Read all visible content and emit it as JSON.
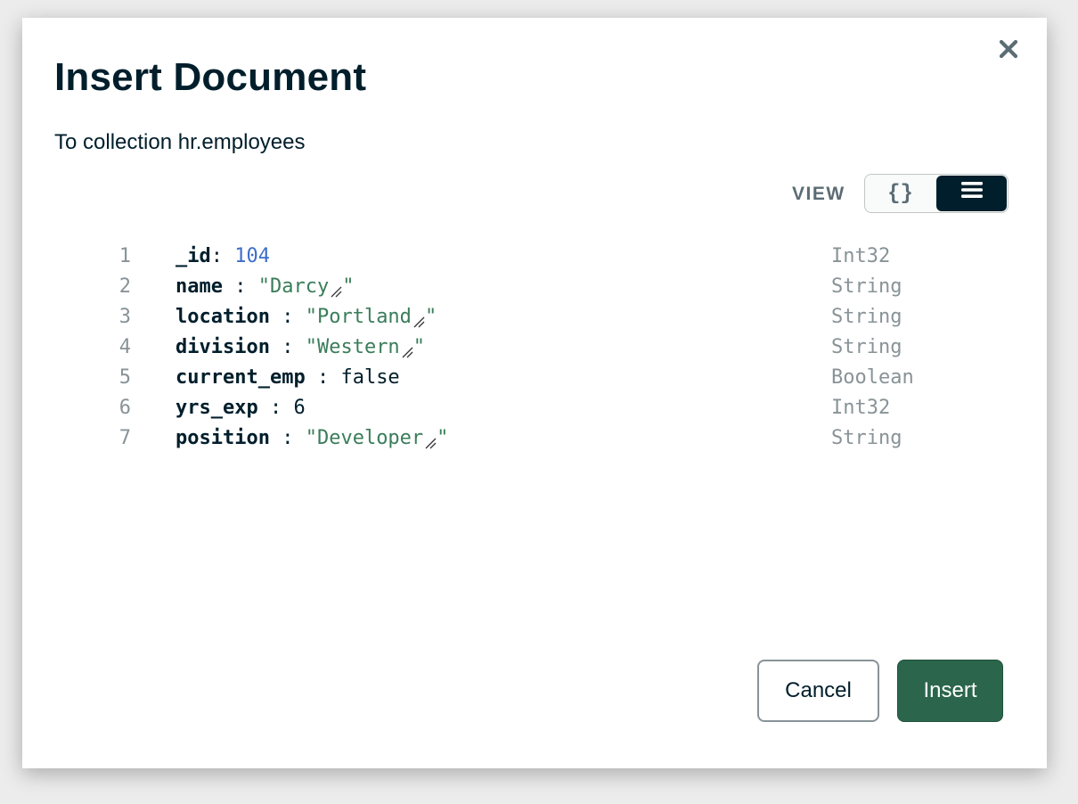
{
  "modal": {
    "title": "Insert Document",
    "subtitle": "To collection hr.employees",
    "close_icon": "close-icon"
  },
  "view_toggle": {
    "label": "VIEW",
    "options": [
      {
        "name": "json-view",
        "icon": "curly-braces-icon",
        "glyph": "{}",
        "active": false
      },
      {
        "name": "list-view",
        "icon": "list-icon",
        "active": true
      }
    ]
  },
  "document": {
    "fields": [
      {
        "line": "1",
        "key": "_id",
        "sep": ": ",
        "value": "104",
        "kind": "number",
        "type": "Int32"
      },
      {
        "line": "2",
        "key": "name",
        "sep": " : ",
        "value": "\"Darcy",
        "end": "\"",
        "kind": "string",
        "type": "String"
      },
      {
        "line": "3",
        "key": "location",
        "sep": " : ",
        "value": "\"Portland",
        "end": "\"",
        "kind": "string",
        "type": "String"
      },
      {
        "line": "4",
        "key": "division",
        "sep": " : ",
        "value": "\"Western",
        "end": "\"",
        "kind": "string",
        "type": "String"
      },
      {
        "line": "5",
        "key": "current_emp",
        "sep": " : ",
        "value": "false",
        "kind": "boolean",
        "type": "Boolean"
      },
      {
        "line": "6",
        "key": "yrs_exp",
        "sep": " : ",
        "value": "6",
        "kind": "plain",
        "type": "Int32"
      },
      {
        "line": "7",
        "key": "position",
        "sep": " : ",
        "value": "\"Developer",
        "end": "\"",
        "kind": "string",
        "type": "String"
      }
    ]
  },
  "footer": {
    "cancel_label": "Cancel",
    "insert_label": "Insert"
  },
  "colors": {
    "primary_button": "#2b664c",
    "dark_toggle": "#001e2b",
    "string_value": "#3a7d5a",
    "number_value": "#3d6ec9",
    "type_label": "#889397"
  }
}
